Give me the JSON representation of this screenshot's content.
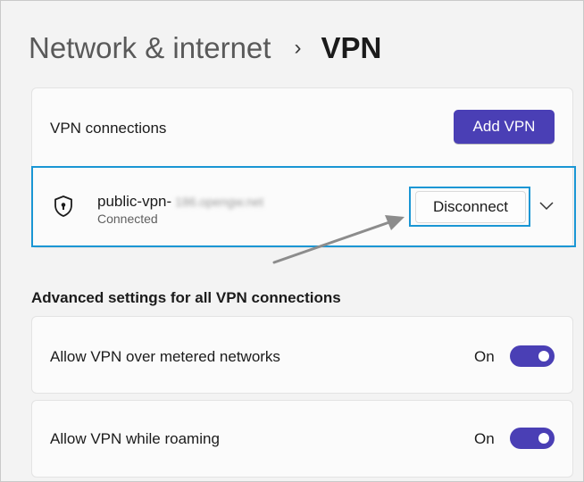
{
  "breadcrumb": {
    "parent": "Network & internet",
    "separator": "›",
    "current": "VPN"
  },
  "vpn_section": {
    "title": "VPN connections",
    "add_button": "Add VPN",
    "connection": {
      "name": "public-vpn-",
      "name_blurred": "186.opengw.net",
      "status": "Connected",
      "disconnect_button": "Disconnect",
      "expand_icon": "chevron-down-icon",
      "icon": "shield-icon"
    }
  },
  "advanced": {
    "title": "Advanced settings for all VPN connections",
    "settings": [
      {
        "label": "Allow VPN over metered networks",
        "state": "On",
        "enabled": true
      },
      {
        "label": "Allow VPN while roaming",
        "state": "On",
        "enabled": true
      }
    ]
  },
  "colors": {
    "accent": "#4a3fb5",
    "highlight": "#1a96d4",
    "background": "#f3f3f3"
  }
}
